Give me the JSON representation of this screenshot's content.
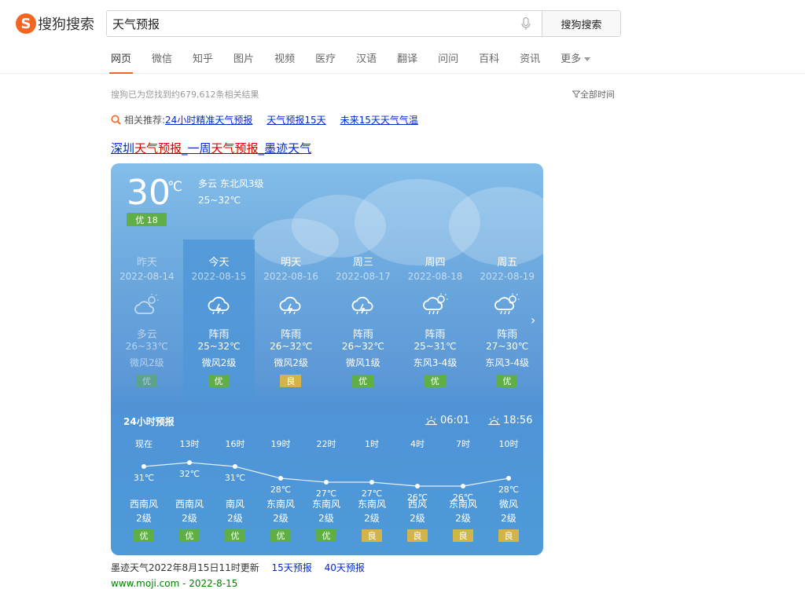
{
  "logo": {
    "mark": "S",
    "text": "搜狗搜索"
  },
  "search": {
    "query": "天气预报",
    "button": "搜狗搜索"
  },
  "tabs": [
    {
      "label": "网页",
      "active": true
    },
    {
      "label": "微信"
    },
    {
      "label": "知乎"
    },
    {
      "label": "图片"
    },
    {
      "label": "视频"
    },
    {
      "label": "医疗"
    },
    {
      "label": "汉语"
    },
    {
      "label": "翻译"
    },
    {
      "label": "问问"
    },
    {
      "label": "百科"
    },
    {
      "label": "资讯"
    },
    {
      "label": "更多"
    }
  ],
  "result_count": "搜狗已为您找到约679,612条相关结果",
  "time_filter": "全部时间",
  "related": {
    "label": "相关推荐:",
    "links": [
      "24小时精准天气预报",
      "天气预报15天",
      "未来15天天气气温"
    ]
  },
  "result_title": {
    "p1": "深圳",
    "h1": "天气预报",
    "p2": "_一周",
    "h2": "天气预报",
    "p3": "_墨迹天气"
  },
  "current": {
    "temp": "30",
    "unit": "℃",
    "aqi": "优 18",
    "condition": "多云  东北风3级",
    "range": "25~32℃"
  },
  "days": [
    {
      "name": "昨天",
      "date": "2022-08-14",
      "icon": "partly-cloudy-icon",
      "cond": "多云",
      "range": "26~33℃",
      "wind": "微风2级",
      "aqi": "优",
      "aqi_color": "#5fae46",
      "past": true
    },
    {
      "name": "今天",
      "date": "2022-08-15",
      "icon": "thunder-shower-icon",
      "cond": "阵雨",
      "range": "25~32℃",
      "wind": "微风2级",
      "aqi": "优",
      "aqi_color": "#5fae46",
      "today": true
    },
    {
      "name": "明天",
      "date": "2022-08-16",
      "icon": "thunder-shower-icon",
      "cond": "阵雨",
      "range": "26~32℃",
      "wind": "微风2级",
      "aqi": "良",
      "aqi_color": "#d2b54a"
    },
    {
      "name": "周三",
      "date": "2022-08-17",
      "icon": "thunder-shower-icon",
      "cond": "阵雨",
      "range": "26~32℃",
      "wind": "微风1级",
      "aqi": "优",
      "aqi_color": "#5fae46"
    },
    {
      "name": "周四",
      "date": "2022-08-18",
      "icon": "sun-shower-icon",
      "cond": "阵雨",
      "range": "25~31℃",
      "wind": "东风3-4级",
      "aqi": "优",
      "aqi_color": "#5fae46"
    },
    {
      "name": "周五",
      "date": "2022-08-19",
      "icon": "sun-shower-icon",
      "cond": "阵雨",
      "range": "27~30℃",
      "wind": "东风3-4级",
      "aqi": "优",
      "aqi_color": "#5fae46"
    }
  ],
  "h24": {
    "title": "24小时预报",
    "sunrise": "06:01",
    "sunset": "18:56",
    "hours": [
      {
        "time": "现在",
        "temp": 31,
        "label": "31℃",
        "wind_dir": "西南风",
        "wind_lvl": "2级",
        "aqi": "优",
        "aqi_color": "#5fae46"
      },
      {
        "time": "13时",
        "temp": 32,
        "label": "32℃",
        "wind_dir": "西南风",
        "wind_lvl": "2级",
        "aqi": "优",
        "aqi_color": "#5fae46"
      },
      {
        "time": "16时",
        "temp": 31,
        "label": "31℃",
        "wind_dir": "南风",
        "wind_lvl": "2级",
        "aqi": "优",
        "aqi_color": "#5fae46"
      },
      {
        "time": "19时",
        "temp": 28,
        "label": "28℃",
        "wind_dir": "东南风",
        "wind_lvl": "2级",
        "aqi": "优",
        "aqi_color": "#5fae46"
      },
      {
        "time": "22时",
        "temp": 27,
        "label": "27℃",
        "wind_dir": "东南风",
        "wind_lvl": "2级",
        "aqi": "优",
        "aqi_color": "#5fae46"
      },
      {
        "time": "1时",
        "temp": 27,
        "label": "27℃",
        "wind_dir": "东南风",
        "wind_lvl": "2级",
        "aqi": "良",
        "aqi_color": "#d2b54a"
      },
      {
        "time": "4时",
        "temp": 26,
        "label": "26℃",
        "wind_dir": "西风",
        "wind_lvl": "2级",
        "aqi": "良",
        "aqi_color": "#d2b54a"
      },
      {
        "time": "7时",
        "temp": 26,
        "label": "26℃",
        "wind_dir": "东南风",
        "wind_lvl": "2级",
        "aqi": "良",
        "aqi_color": "#d2b54a"
      },
      {
        "time": "10时",
        "temp": 28,
        "label": "28℃",
        "wind_dir": "微风",
        "wind_lvl": "2级",
        "aqi": "良",
        "aqi_color": "#d2b54a"
      }
    ]
  },
  "footer": {
    "text": "墨迹天气2022年8月15日11时更新",
    "link1": "15天预报",
    "link2": "40天预报",
    "url": "www.moji.com - 2022-8-15"
  }
}
